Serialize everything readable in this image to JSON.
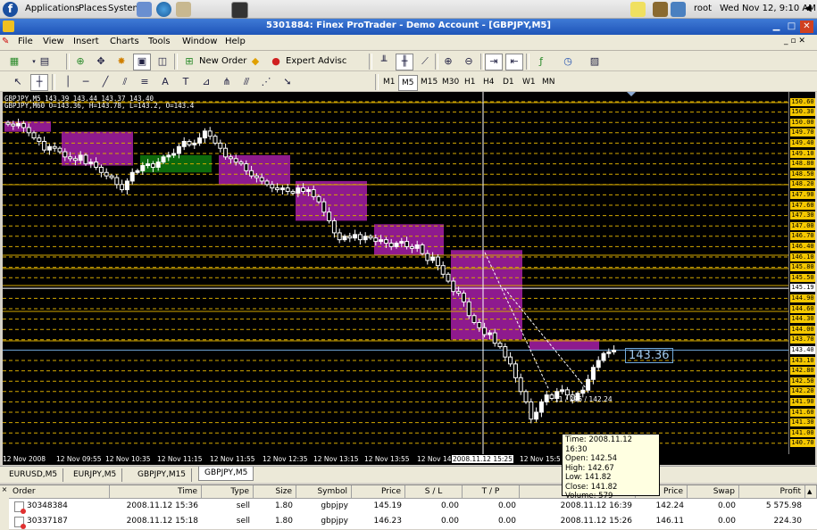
{
  "desktop": {
    "menus": [
      "Applications",
      "Places",
      "System"
    ],
    "user": "root",
    "clock": "Wed Nov 12, 9:10 AM"
  },
  "window": {
    "title": "5301884: Finex ProTrader - Demo Account - [GBPJPY,M5]"
  },
  "menubar": [
    "File",
    "View",
    "Insert",
    "Charts",
    "Tools",
    "Window",
    "Help"
  ],
  "toolbar": {
    "new_order": "New Order",
    "expert": "Expert Advisc",
    "timeframes": [
      "M1",
      "M5",
      "M15",
      "M30",
      "H1",
      "H4",
      "D1",
      "W1",
      "MN"
    ],
    "active_timeframe": "M5"
  },
  "chart": {
    "info_line1": "GBPJPY,M5  143.39 143.44 143.37 143.40",
    "info_line2": "GBPJPY,M60  O=143.36, H=143.78, L=143.2, O=143.4",
    "price_tag": "143.36",
    "trade_label": "11 / 295 / 142.24",
    "x_labels": [
      "12 Nov 2008",
      "12 Nov 09:55",
      "12 Nov 10:35",
      "12 Nov 11:15",
      "12 Nov 11:55",
      "12 Nov 12:35",
      "12 Nov 13:15",
      "12 Nov 13:55",
      "12 Nov 14:",
      "2008.11.12 15:25",
      "12 Nov 15:5"
    ],
    "y_labels": [
      "150.60",
      "150.30",
      "150.00",
      "149.70",
      "149.40",
      "149.10",
      "148.80",
      "148.50",
      "148.20",
      "147.90",
      "147.60",
      "147.30",
      "147.00",
      "146.70",
      "146.40",
      "146.10",
      "145.80",
      "145.50",
      "145.19",
      "144.90",
      "144.60",
      "144.30",
      "144.00",
      "143.70",
      "143.40",
      "143.10",
      "142.80",
      "142.50",
      "142.20",
      "141.90",
      "141.60",
      "141.30",
      "141.00",
      "140.70"
    ],
    "tooltip": {
      "time": "Time: 2008.11.12 16:30",
      "open": "Open: 142.54",
      "high": "High: 142.67",
      "low": "Low: 141.82",
      "close": "Close: 141.82",
      "volume": "Volume: 579"
    },
    "colors": {
      "bear_box": "#8e1a8e",
      "bull_box": "#0c6a0c",
      "grid_dash": "#d4a800",
      "candle": "#ffffff",
      "axis_label_bg": "#f5c800"
    }
  },
  "chart_tabs": [
    "EURUSD,M5",
    "EURJPY,M5",
    "GBPJPY,M15",
    "GBPJPY,M5"
  ],
  "active_chart_tab": "GBPJPY,M5",
  "terminal": {
    "columns": [
      "Order",
      "Time",
      "Type",
      "Size",
      "Symbol",
      "Price",
      "S / L",
      "T / P",
      "",
      "Price",
      "Swap",
      "Profit"
    ],
    "rows": [
      {
        "order": "30348384",
        "time": "2008.11.12 15:36",
        "type": "sell",
        "size": "1.80",
        "symbol": "gbpjpy",
        "price": "145.19",
        "sl": "0.00",
        "tp": "0.00",
        "close_time": "2008.11.12 16:39",
        "close_price": "142.24",
        "swap": "0.00",
        "profit": "5 575.98"
      },
      {
        "order": "30337187",
        "time": "2008.11.12 15:18",
        "type": "sell",
        "size": "1.80",
        "symbol": "gbpjpy",
        "price": "146.23",
        "sl": "0.00",
        "tp": "0.00",
        "close_time": "2008.11.12 15:26",
        "close_price": "146.11",
        "swap": "0.00",
        "profit": "224.30"
      }
    ]
  }
}
